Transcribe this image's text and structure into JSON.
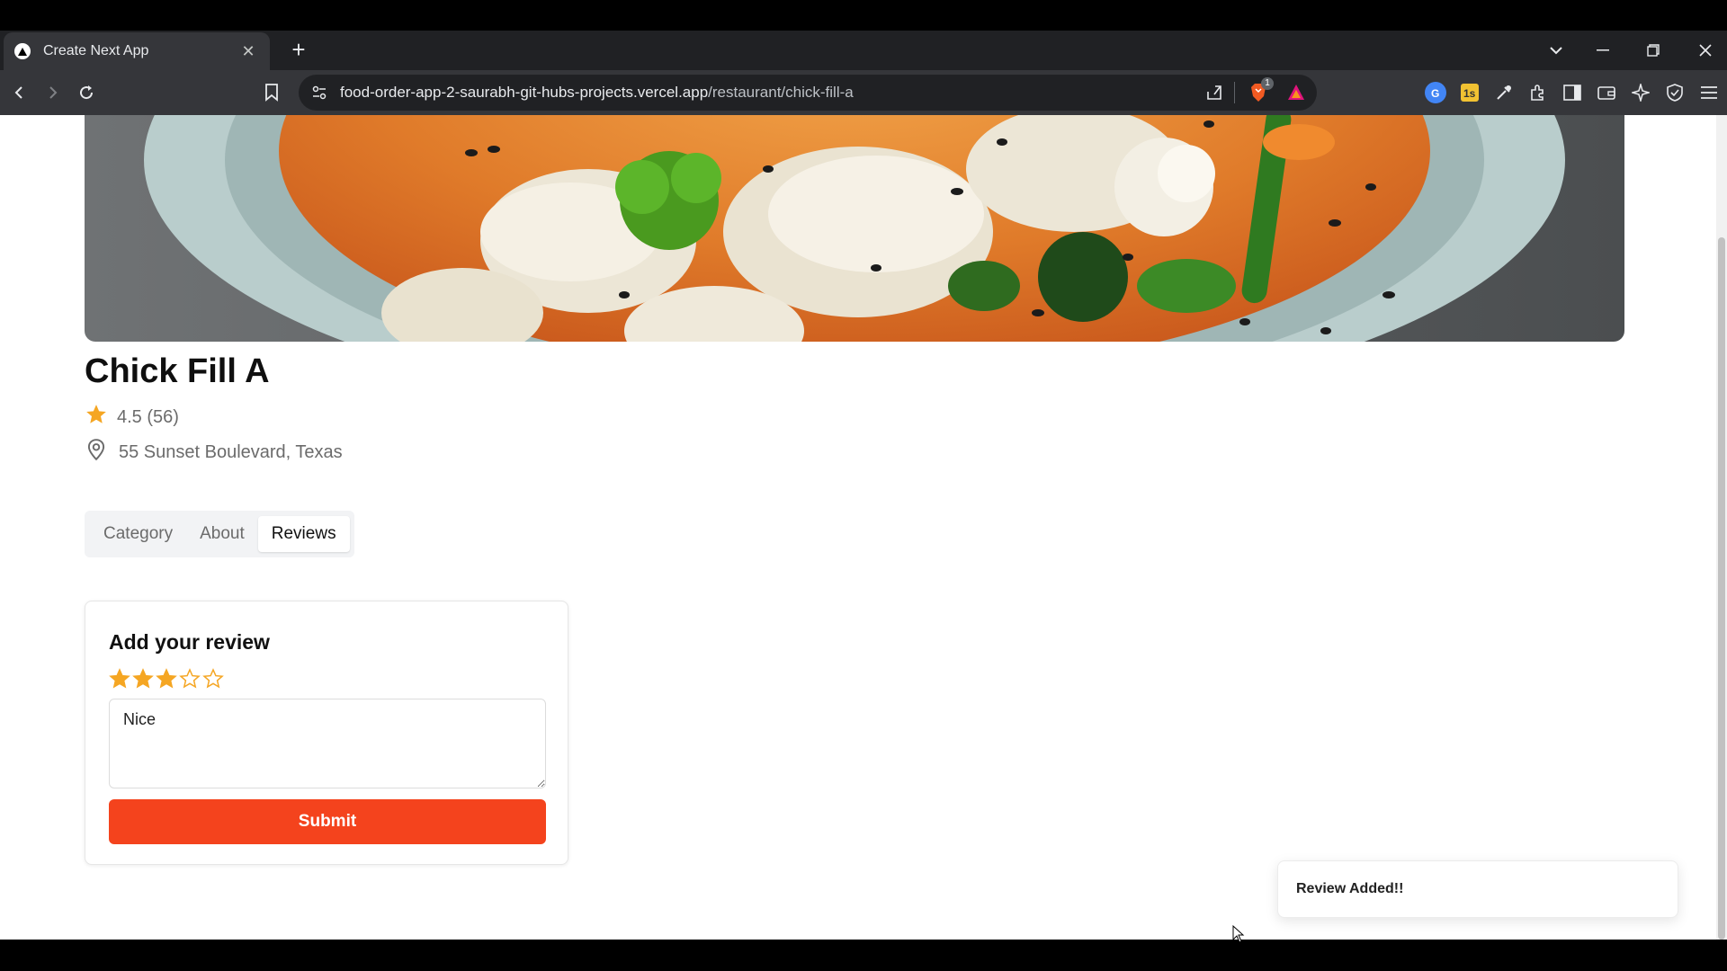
{
  "browser": {
    "tab_title": "Create Next App",
    "url_host": "food-order-app-2-saurabh-git-hubs-projects.vercel.app",
    "url_path": "/restaurant/chick-fill-a",
    "brave_badge": "1"
  },
  "restaurant": {
    "name": "Chick Fill A",
    "rating": "4.5 (56)",
    "address": "55 Sunset Boulevard, Texas"
  },
  "tabs": [
    {
      "label": "Category",
      "active": false
    },
    {
      "label": "About",
      "active": false
    },
    {
      "label": "Reviews",
      "active": true
    }
  ],
  "review_form": {
    "title": "Add your review",
    "rating_value": 3,
    "rating_max": 5,
    "text": "Nice",
    "submit_label": "Submit"
  },
  "toast": {
    "message": "Review Added!!"
  },
  "colors": {
    "accent": "#f4431d",
    "star": "#f5a623"
  }
}
